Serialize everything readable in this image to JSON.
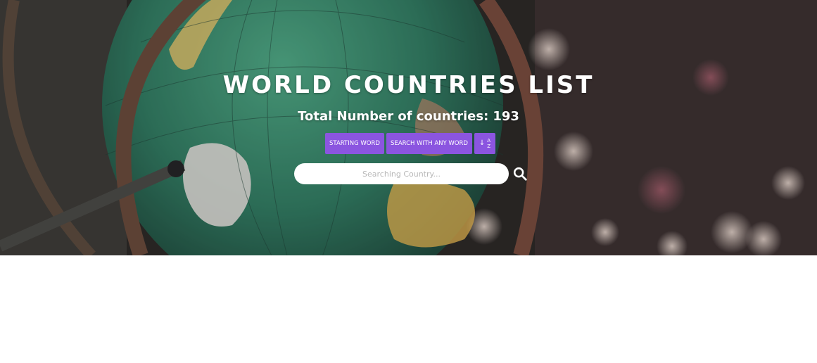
{
  "header": {
    "title": "WORLD COUNTRIES LIST",
    "subtitle_label": "Total Number of countries:",
    "country_count": "193"
  },
  "buttons": {
    "starting_word": "STARTING WORD",
    "any_word": "SEARCH WITH ANY WORD",
    "sort_arrow": "↓",
    "sort_top": "A",
    "sort_bottom": "Z"
  },
  "search": {
    "placeholder": "Searching Country...",
    "value": "",
    "icon": "search-icon"
  },
  "colors": {
    "button_bg": "#8b55e0",
    "title_text": "#ffffff",
    "input_bg": "#ffffff"
  },
  "background": {
    "image": "globe-photo"
  }
}
